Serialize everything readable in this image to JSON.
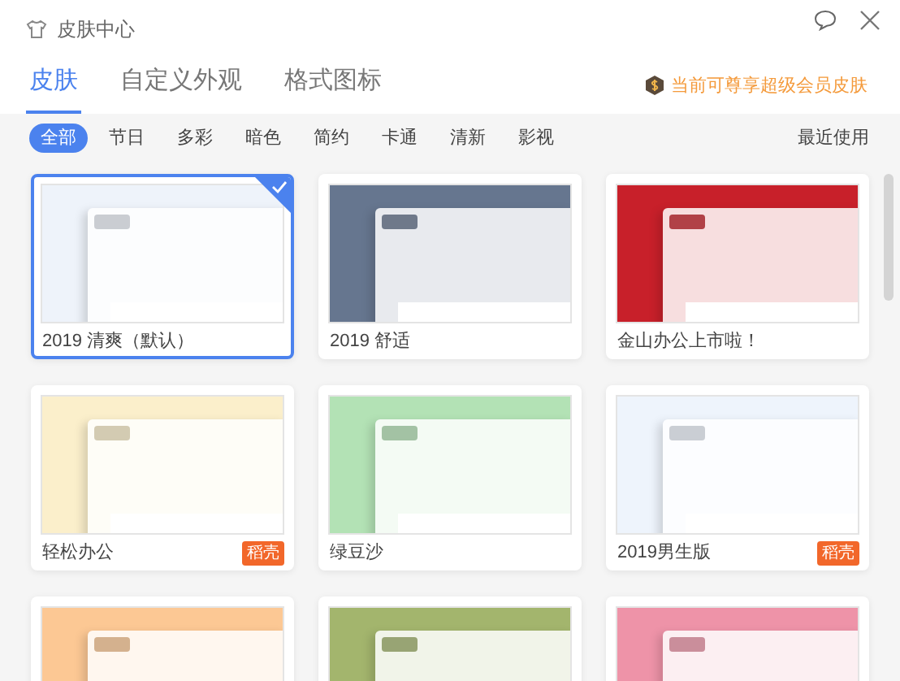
{
  "window": {
    "title": "皮肤中心"
  },
  "tabs": [
    {
      "label": "皮肤",
      "selected": true
    },
    {
      "label": "自定义外观",
      "selected": false
    },
    {
      "label": "格式图标",
      "selected": false
    }
  ],
  "vip_notice": "当前可尊享超级会员皮肤",
  "filters": [
    {
      "label": "全部",
      "selected": true
    },
    {
      "label": "节日",
      "selected": false
    },
    {
      "label": "多彩",
      "selected": false
    },
    {
      "label": "暗色",
      "selected": false
    },
    {
      "label": "简约",
      "selected": false
    },
    {
      "label": "卡通",
      "selected": false
    },
    {
      "label": "清新",
      "selected": false
    },
    {
      "label": "影视",
      "selected": false
    }
  ],
  "recent_link": "最近使用",
  "skins": [
    {
      "label": "2019 清爽（默认）",
      "selected": true,
      "color": "#eef3fa"
    },
    {
      "label": "2019 舒适",
      "selected": false,
      "color": "#66768f"
    },
    {
      "label": "金山办公上市啦！",
      "selected": false,
      "color": "#c8202a"
    },
    {
      "label": "轻松办公",
      "selected": false,
      "color": "#fbefcb",
      "badge": "稻壳"
    },
    {
      "label": "绿豆沙",
      "selected": false,
      "color": "#b3e2b5"
    },
    {
      "label": "2019男生版",
      "selected": false,
      "color": "#eef4fc",
      "badge": "稻壳"
    },
    {
      "selected": false,
      "color": "#fcc894"
    },
    {
      "selected": false,
      "color": "#a3b56d"
    },
    {
      "selected": false,
      "color": "#ee93a8"
    }
  ]
}
